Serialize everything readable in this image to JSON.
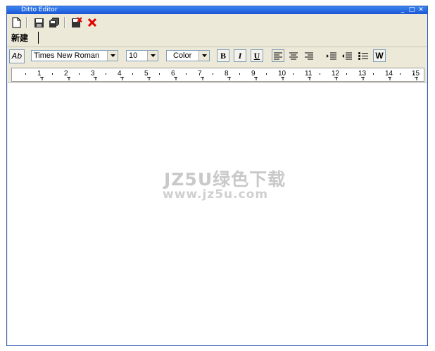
{
  "window": {
    "title": "Ditto Editor",
    "min_icon": "minimize-icon",
    "max_icon": "maximize-icon",
    "close_icon": "close-icon"
  },
  "toolbar": {
    "icons": [
      "new-document-icon",
      "save-icon",
      "save-all-icon",
      "save-close-icon",
      "delete-icon"
    ]
  },
  "tabs": [
    {
      "label": "新建"
    }
  ],
  "format": {
    "font_name": "Times New Roman",
    "font_size": "10",
    "color_label": "Color",
    "ab_label": "Ab",
    "bold": "B",
    "italic": "I",
    "underline": "U",
    "w_label": "W"
  },
  "ruler": {
    "numbers": [
      "1",
      "2",
      "3",
      "4",
      "5",
      "6",
      "7",
      "8",
      "9",
      "10",
      "11",
      "12",
      "13",
      "14",
      "15"
    ]
  },
  "watermark": {
    "line1": "JZ5U绿色下载",
    "line2": "www.jz5u.com"
  }
}
